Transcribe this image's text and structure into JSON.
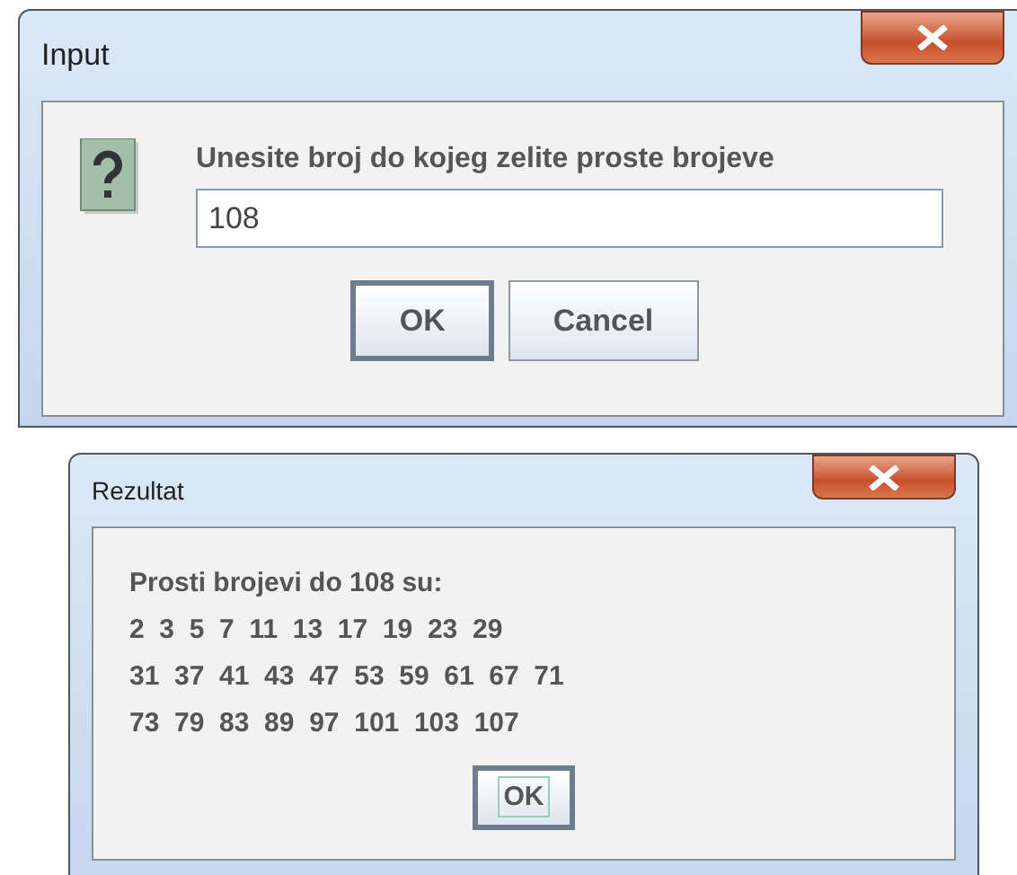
{
  "dialogs": [
    {
      "title": "Input",
      "message": "Unesite broj do kojeg zelite proste brojeve",
      "input": {
        "value": "108"
      },
      "buttons": [
        {
          "label": "OK",
          "focused": true
        },
        {
          "label": "Cancel",
          "focused": false
        }
      ]
    },
    {
      "title": "Rezultat",
      "message": "Prosti brojevi do 108 su:",
      "lines": [
        "2  3  5  7  11  13  17  19  23  29",
        "31  37  41  43  47  53  59  61  67  71",
        "73  79  83  89  97  101  103  107"
      ],
      "buttons": [
        {
          "label": "OK",
          "focused": true
        }
      ]
    }
  ]
}
